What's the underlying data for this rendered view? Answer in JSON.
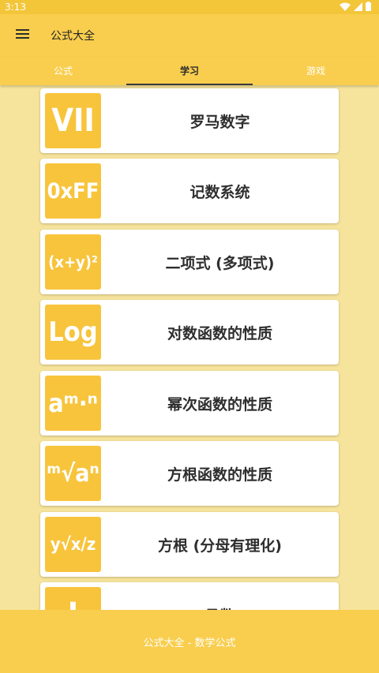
{
  "status": {
    "time": "3:13"
  },
  "app_bar": {
    "title": "公式大全",
    "menu_icon": "hamburger-menu-icon"
  },
  "tabs": [
    {
      "label": "公式",
      "active": false
    },
    {
      "label": "学习",
      "active": true
    },
    {
      "label": "游戏",
      "active": false
    }
  ],
  "items": [
    {
      "icon_text": "VII",
      "label": "罗马数字"
    },
    {
      "icon_text": "0xFF",
      "label": "记数系统"
    },
    {
      "icon_text": "(x+y)²",
      "label": "二项式 (多项式)"
    },
    {
      "icon_text": "Log",
      "label": "对数函数的性质"
    },
    {
      "icon_text": "aᵐ·ⁿ",
      "label": "幂次函数的性质"
    },
    {
      "icon_text": "ᵐ√aⁿ",
      "label": "方根函数的性质"
    },
    {
      "icon_text": "y√x/z",
      "label": "方根 (分母有理化)"
    },
    {
      "icon_text": "I",
      "label": "函数"
    }
  ],
  "footer": {
    "text": "公式大全 - 数学公式"
  },
  "colors": {
    "accent": "#f9ce4e",
    "status_bar": "#f3c63a",
    "background": "#f7e49c",
    "icon_bg": "#f7c43c"
  }
}
